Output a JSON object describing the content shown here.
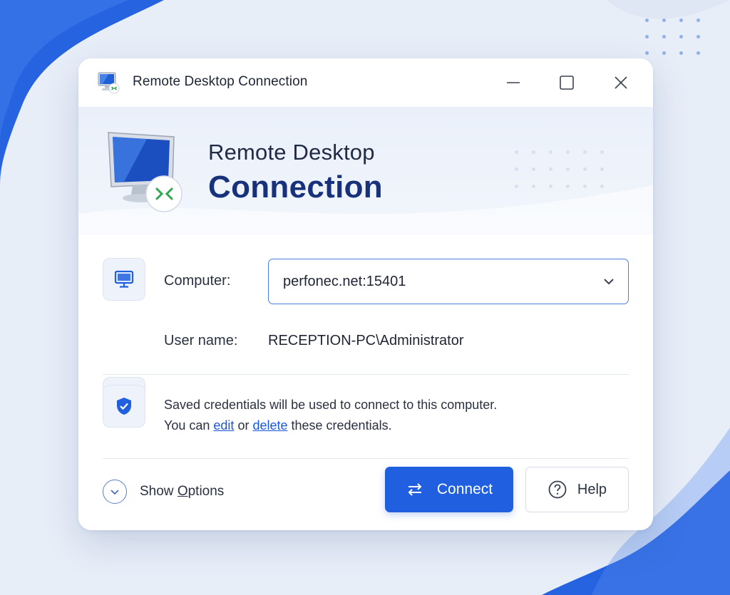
{
  "window": {
    "title": "Remote Desktop Connection"
  },
  "banner": {
    "line1": "Remote Desktop",
    "line2": "Connection"
  },
  "form": {
    "computer_label": "Computer:",
    "computer_value": "perfonec.net:15401",
    "username_label": "User name:",
    "username_value": "RECEPTION-PC\\Administrator"
  },
  "credentials": {
    "line1": "Saved credentials will be used to connect to this computer.",
    "prefix": "You can ",
    "edit_link": "edit",
    "middle": " or ",
    "delete_link": "delete",
    "suffix": " these credentials."
  },
  "footer": {
    "show_options_before": "Show ",
    "show_options_accel": "O",
    "show_options_after": "ptions",
    "connect_label": "Connect",
    "help_label": "Help"
  },
  "icons": {
    "title": "remote-desktop-icon",
    "banner": "monitor-connection-icon",
    "computer": "monitor-icon",
    "user": "user-icon",
    "shield": "shield-check-icon",
    "caret": "chevron-down-icon",
    "connect": "swap-arrows-icon",
    "help": "question-circle-icon"
  },
  "colors": {
    "accent": "#1f5fe0",
    "title_dark_blue": "#17327a",
    "link": "#1a57d6",
    "connection_green": "#2fa84f"
  }
}
